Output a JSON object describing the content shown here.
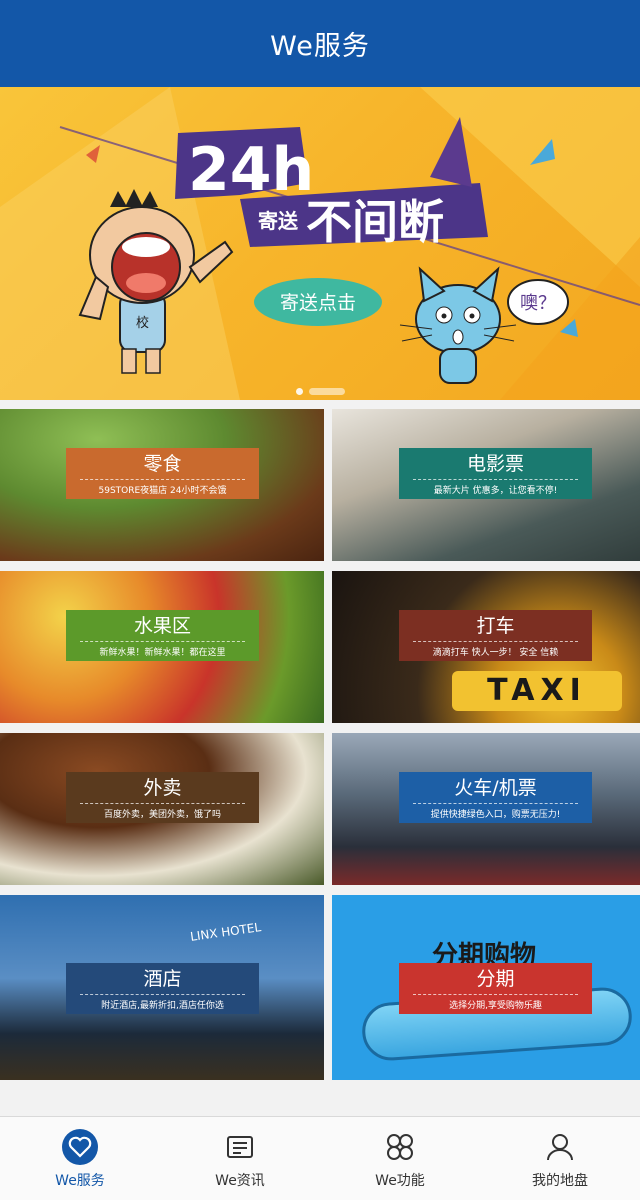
{
  "header": {
    "title": "We服务"
  },
  "banner": {
    "headline_num": "24h",
    "headline_small": "寄送",
    "headline_big": "不间断",
    "cta": "寄送点击",
    "bubble": "噢？",
    "shirt": "校"
  },
  "services": [
    {
      "name": "零食",
      "sub": "59STORE夜猫店 24小时不会饿",
      "color": "#c96a2e"
    },
    {
      "name": "电影票",
      "sub": "最新大片 优惠多，让您看不停!",
      "color": "#1a7a70"
    },
    {
      "name": "水果区",
      "sub": "新鲜水果！新鲜水果！都在这里",
      "color": "#5c9a2a"
    },
    {
      "name": "打车",
      "sub": "滴滴打车 快人一步！ 安全 信赖",
      "color": "#7c2f22"
    },
    {
      "name": "外卖",
      "sub": "百度外卖，美团外卖，饿了吗",
      "color": "#5a3a1e"
    },
    {
      "name": "火车/机票",
      "sub": "提供快捷绿色入口，购票无压力!",
      "color": "#1d5fa6"
    },
    {
      "name": "酒店",
      "sub": "附近酒店,最新折扣,酒店任你选",
      "color": "#244a7a"
    },
    {
      "name": "分期",
      "sub": "选择分期,享受购物乐趣",
      "color": "#c9342e"
    }
  ],
  "tabs": [
    {
      "label": "We服务",
      "icon": "heart-icon"
    },
    {
      "label": "We资讯",
      "icon": "news-icon"
    },
    {
      "label": "We功能",
      "icon": "grid-icon"
    },
    {
      "label": "我的地盘",
      "icon": "user-icon"
    }
  ],
  "tile_images": {
    "hotel_sign": "LINX HOTEL",
    "taxi_sign": "TAXI",
    "installment_sign": "分期购物"
  }
}
